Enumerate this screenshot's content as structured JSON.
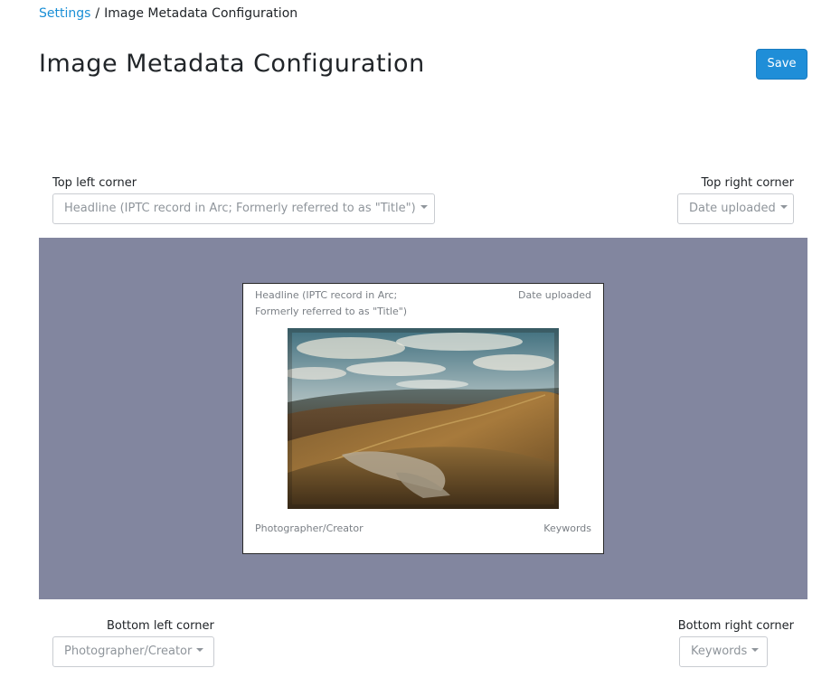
{
  "breadcrumb": {
    "parent": "Settings",
    "separator": "/",
    "current": "Image Metadata Configuration"
  },
  "page_title": "Image Metadata Configuration",
  "toolbar": {
    "save_label": "Save"
  },
  "corners": {
    "top_left": {
      "label": "Top left corner",
      "selected": "Headline (IPTC record in Arc; Formerly referred to as \"Title\")"
    },
    "top_right": {
      "label": "Top right corner",
      "selected": "Date uploaded"
    },
    "bottom_left": {
      "label": "Bottom left corner",
      "selected": "Photographer/Creator"
    },
    "bottom_right": {
      "label": "Bottom right corner",
      "selected": "Keywords"
    }
  },
  "preview": {
    "top_left_line1": "Headline (IPTC record in Arc;",
    "top_left_line2": "Formerly referred to as \"Title\")",
    "top_right": "Date uploaded",
    "bottom_left": "Photographer/Creator",
    "bottom_right": "Keywords",
    "image_icon": "landscape-photo"
  },
  "colors": {
    "accent": "#1f8ed8",
    "link": "#1a8fd6",
    "preview_background": "#82869f"
  }
}
